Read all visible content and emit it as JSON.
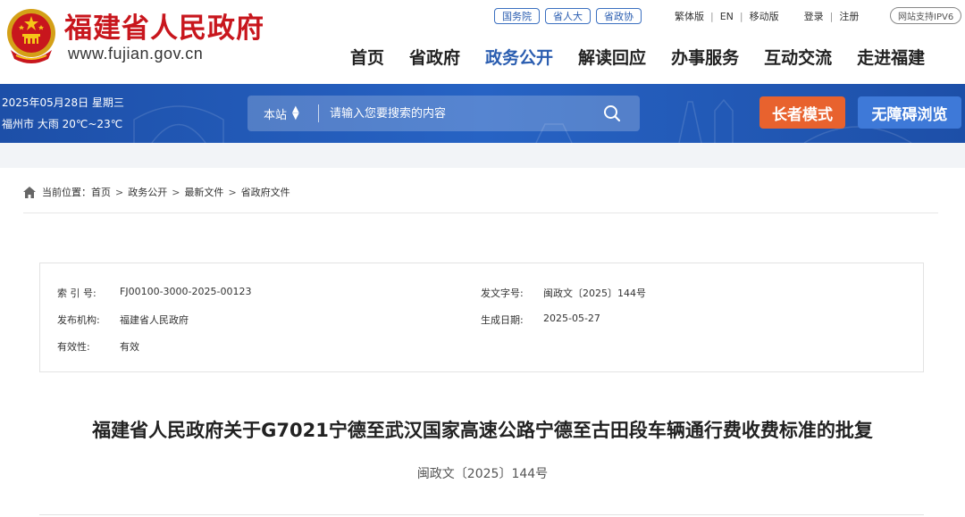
{
  "header": {
    "site_name": "福建省人民政府",
    "site_url": "www.fujian.gov.cn",
    "emblem_icon": "national-emblem-icon",
    "brand_color": "#c8161d",
    "quick_links": [
      "国务院",
      "省人大",
      "省政协"
    ],
    "util_links": [
      "繁体版",
      "EN",
      "移动版"
    ],
    "login": "登录",
    "register": "注册",
    "ipv6_badge": "网站支持IPV6",
    "nav": [
      "首页",
      "省政府",
      "政务公开",
      "解读回应",
      "办事服务",
      "互动交流",
      "走进福建"
    ],
    "nav_active": "政务公开",
    "active_color": "#2a5db0"
  },
  "banner": {
    "date": "2025年05月28日 星期三",
    "weather": "福州市 大雨 20℃~23℃",
    "search_scope": "本站",
    "search_placeholder": "请输入您要搜索的内容",
    "elder_mode": "长者模式",
    "accessible": "无障碍浏览",
    "banner_color": "#1d4fa8",
    "elder_color": "#e8622e"
  },
  "breadcrumb": {
    "prefix": "当前位置：",
    "items": [
      "首页",
      "政务公开",
      "最新文件",
      "省政府文件"
    ]
  },
  "meta": {
    "index_label": "索 引 号:",
    "index_value": "FJ00100-3000-2025-00123",
    "doc_no_label": "发文字号:",
    "doc_no_value": "闽政文〔2025〕144号",
    "publisher_label": "发布机构:",
    "publisher_value": "福建省人民政府",
    "date_label": "生成日期:",
    "date_value": "2025-05-27",
    "validity_label": "有效性:",
    "validity_value": "有效"
  },
  "document": {
    "title": "福建省人民政府关于G7021宁德至武汉国家高速公路宁德至古田段车辆通行费收费标准的批复",
    "number": "闽政文〔2025〕144号"
  }
}
